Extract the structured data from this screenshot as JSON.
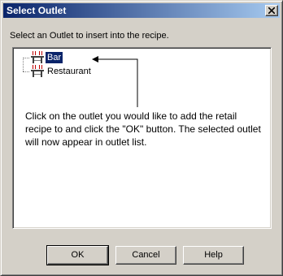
{
  "window": {
    "title": "Select Outlet"
  },
  "prompt": "Select an Outlet to insert into the recipe.",
  "tree": {
    "items": [
      {
        "label": "Bar",
        "selected": true
      },
      {
        "label": "Restaurant",
        "selected": false
      }
    ]
  },
  "annotation": "Click on the outlet you would like to add the retail recipe to and click the \"OK\" button. The selected outlet will now appear in outlet list.",
  "buttons": {
    "ok": "OK",
    "cancel": "Cancel",
    "help": "Help"
  },
  "colors": {
    "face": "#d4d0c8",
    "title_start": "#0a246a",
    "title_end": "#a6caf0",
    "selection": "#0a246a"
  }
}
